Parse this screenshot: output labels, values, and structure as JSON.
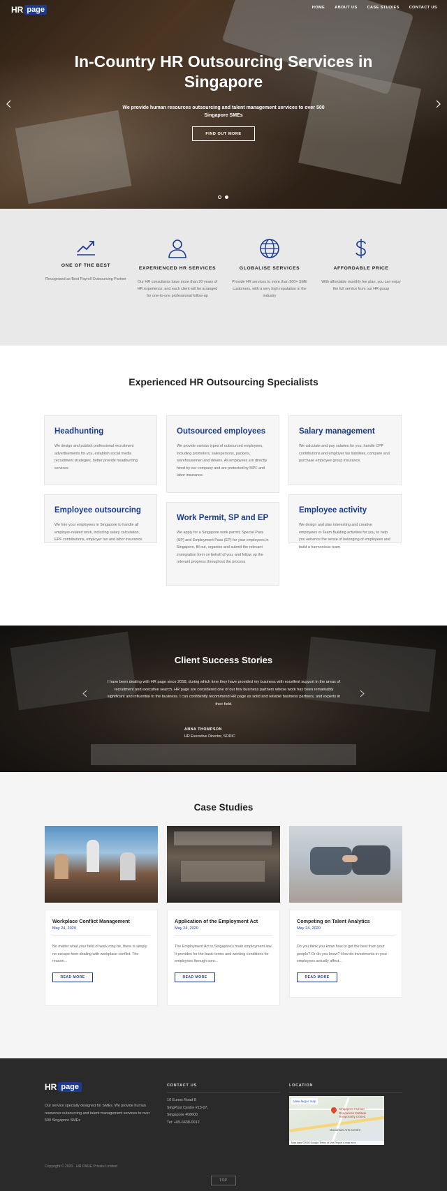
{
  "header": {
    "logo_hr": "HR",
    "logo_page": "page",
    "nav": [
      "HOME",
      "ABOUT US",
      "CASE STUDIES",
      "CONTACT US"
    ]
  },
  "hero": {
    "title": "In-Country HR Outsourcing Services in Singapore",
    "subtitle": "We provide human resources outsourcing and talent management services to over 500 Singapore SMEs",
    "cta": "FIND OUT MORE",
    "prev_icon": "chevron-left-icon",
    "next_icon": "chevron-right-icon",
    "active_slide": 2,
    "slide_count": 2
  },
  "features": [
    {
      "icon": "trend-up-icon",
      "title": "ONE OF THE BEST",
      "text": "Recognised as Best Payroll Outsourcing Partner"
    },
    {
      "icon": "user-icon",
      "title": "EXPERIENCED HR SERVICES",
      "text": "Our HR consultants have more than 20 years of HR experience, and each client will be arranged for one-to-one professional follow-up"
    },
    {
      "icon": "globe-icon",
      "title": "GLOBALISE SERVICES",
      "text": "Provide HR services to more than 500+ SME customers, with a very high reputation in the industry"
    },
    {
      "icon": "dollar-icon",
      "title": "AFFORDABLE PRICE",
      "text": "With affordable monthly fee plan, you can enjoy the full service from our HR group"
    }
  ],
  "specialists": {
    "title": "Experienced HR Outsourcing Specialists",
    "cards": [
      {
        "title": "Headhunting",
        "text": "We design and publish professional recruitment advertisements for you, establish social media recruitment strategies, better provide headhunting services"
      },
      {
        "title": "Outsourced employees",
        "text": "We provide various types of outsourced employees, including promoters, salespersons, packers, warehousemen and drivers. All employees are directly hired by our company and are protected by MPF and labor insurance."
      },
      {
        "title": "Salary management",
        "text": "We calculate and pay salaries for you, handle CPF contributions and employer tax liabilities, compare and purchase employee group insurance."
      },
      {
        "title": "Employee outsourcing",
        "text": "We hire your employees in Singapore to handle all employer-related work, including salary calculation, EPF contributions, employer tax and labor insurance."
      },
      {
        "title": "Work Permit, SP and EP",
        "text": "We apply for a Singapore work permit, Special Pass (SP) and Employment Pass (EP) for your employees in Singapore, fill out, organise and submit the relevant immigration form on behalf of you, and follow up the relevant progress throughout the process"
      },
      {
        "title": "Employee activity",
        "text": "We design and plan interesting and creative employees or Team Building activities for you, to help you enhance the sense of belonging of employees and build a harmonious team."
      }
    ]
  },
  "testimonial": {
    "title": "Client Success Stories",
    "quote": "I have been dealing with HR page since 2018, during which time they have provided my business with excellent support in the areas of recruitment and executive search. HR page are considered one of our few business partners whose work has been remarkably significant and influential to the business. I can confidently recommend HR page as solid and reliable business partners, and experts in their field.",
    "name": "ANNA THOMPSON",
    "role": "HR Executive Director, SODIC"
  },
  "cases": {
    "title": "Case Studies",
    "items": [
      {
        "title": "Workplace Conflict Management",
        "date": "May 24, 2020",
        "excerpt": "No matter what your field of work may be, there is simply no escape from dealing with workplace conflict. The reason...",
        "button": "READ MORE"
      },
      {
        "title": "Application of the Employment Act",
        "date": "May 24, 2020",
        "excerpt": "The Employment Act is Singapore's main employment law. It provides for the basic terms and working conditions for employees through core...",
        "button": "READ MORE"
      },
      {
        "title": "Competing on Talent Analytics",
        "date": "May 24, 2020",
        "excerpt": "Do you think you know how to get the best from your people? Or do you know? How do investments in your employees actually affect...",
        "button": "READ MORE"
      }
    ]
  },
  "footer": {
    "about": "Our service specially designed for SMEs. We provide human resources outsourcing and talent management services to over 500 Singapore SMEs",
    "contact_heading": "CONTACT US",
    "address": [
      "10 Eunos Road 8",
      "SingPost Centre #13-07,",
      "Singapore 408600",
      "Tel: +65-6438-0012"
    ],
    "location_heading": "LOCATION",
    "map_link": "View larger map",
    "map_place": "Singapore Human Resources Institute",
    "map_place_note": "Temporarily closed",
    "map_arts": "Goodman Arts Centre",
    "map_footer": "Map data ©2020 Google   Terms of Use   Report a map error",
    "copyright": "Copyright © 2020 · HR PAGE Private Limited",
    "top_button": "TOP"
  },
  "colors": {
    "brand_blue": "#1c3a8f",
    "footer_bg": "#2a2a2a",
    "features_bg": "#e9e9e9"
  }
}
